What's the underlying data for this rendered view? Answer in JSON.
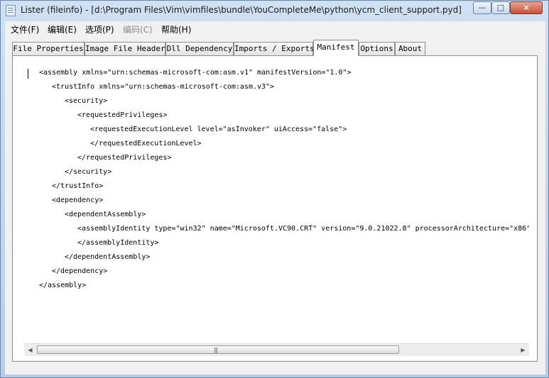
{
  "window": {
    "title": "Lister (fileinfo) - [d:\\Program Files\\Vim\\vimfiles\\bundle\\YouCompleteMe\\python\\ycm_client_support.pyd]",
    "minimize_glyph": "—",
    "maximize_glyph": "□",
    "close_glyph": "✕"
  },
  "menu": {
    "items": [
      {
        "label": "文件(F)",
        "enabled": true
      },
      {
        "label": "编辑(E)",
        "enabled": true
      },
      {
        "label": "选项(P)",
        "enabled": true
      },
      {
        "label": "编码(C)",
        "enabled": false
      },
      {
        "label": "帮助(H)",
        "enabled": true
      }
    ]
  },
  "tabs": [
    {
      "label": "File Properties",
      "active": false
    },
    {
      "label": "Image File Header",
      "active": false
    },
    {
      "label": "Dll Dependency",
      "active": false
    },
    {
      "label": "Imports / Exports",
      "active": false
    },
    {
      "label": "Manifest",
      "active": true
    },
    {
      "label": "Options",
      "active": false
    },
    {
      "label": "About",
      "active": false
    }
  ],
  "manifest": {
    "lines": [
      "<assembly xmlns=\"urn:schemas-microsoft-com:asm.v1\" manifestVersion=\"1.0\">",
      "<trustInfo xmlns=\"urn:schemas-microsoft-com:asm.v3\">",
      "<security>",
      "<requestedPrivileges>",
      "<requestedExecutionLevel level=\"asInvoker\" uiAccess=\"false\">",
      "</requestedExecutionLevel>",
      "</requestedPrivileges>",
      "</security>",
      "</trustInfo>",
      "<dependency>",
      "<dependentAssembly>",
      "<assemblyIdentity type=\"win32\" name=\"Microsoft.VC90.CRT\" version=\"9.0.21022.8\" processorArchitecture=\"x86\"",
      "</assemblyIdentity>",
      "</dependentAssembly>",
      "</dependency>",
      "</assembly>"
    ]
  },
  "scrollbar": {
    "left_arrow": "◀",
    "right_arrow": "▶",
    "grip": "|||"
  }
}
